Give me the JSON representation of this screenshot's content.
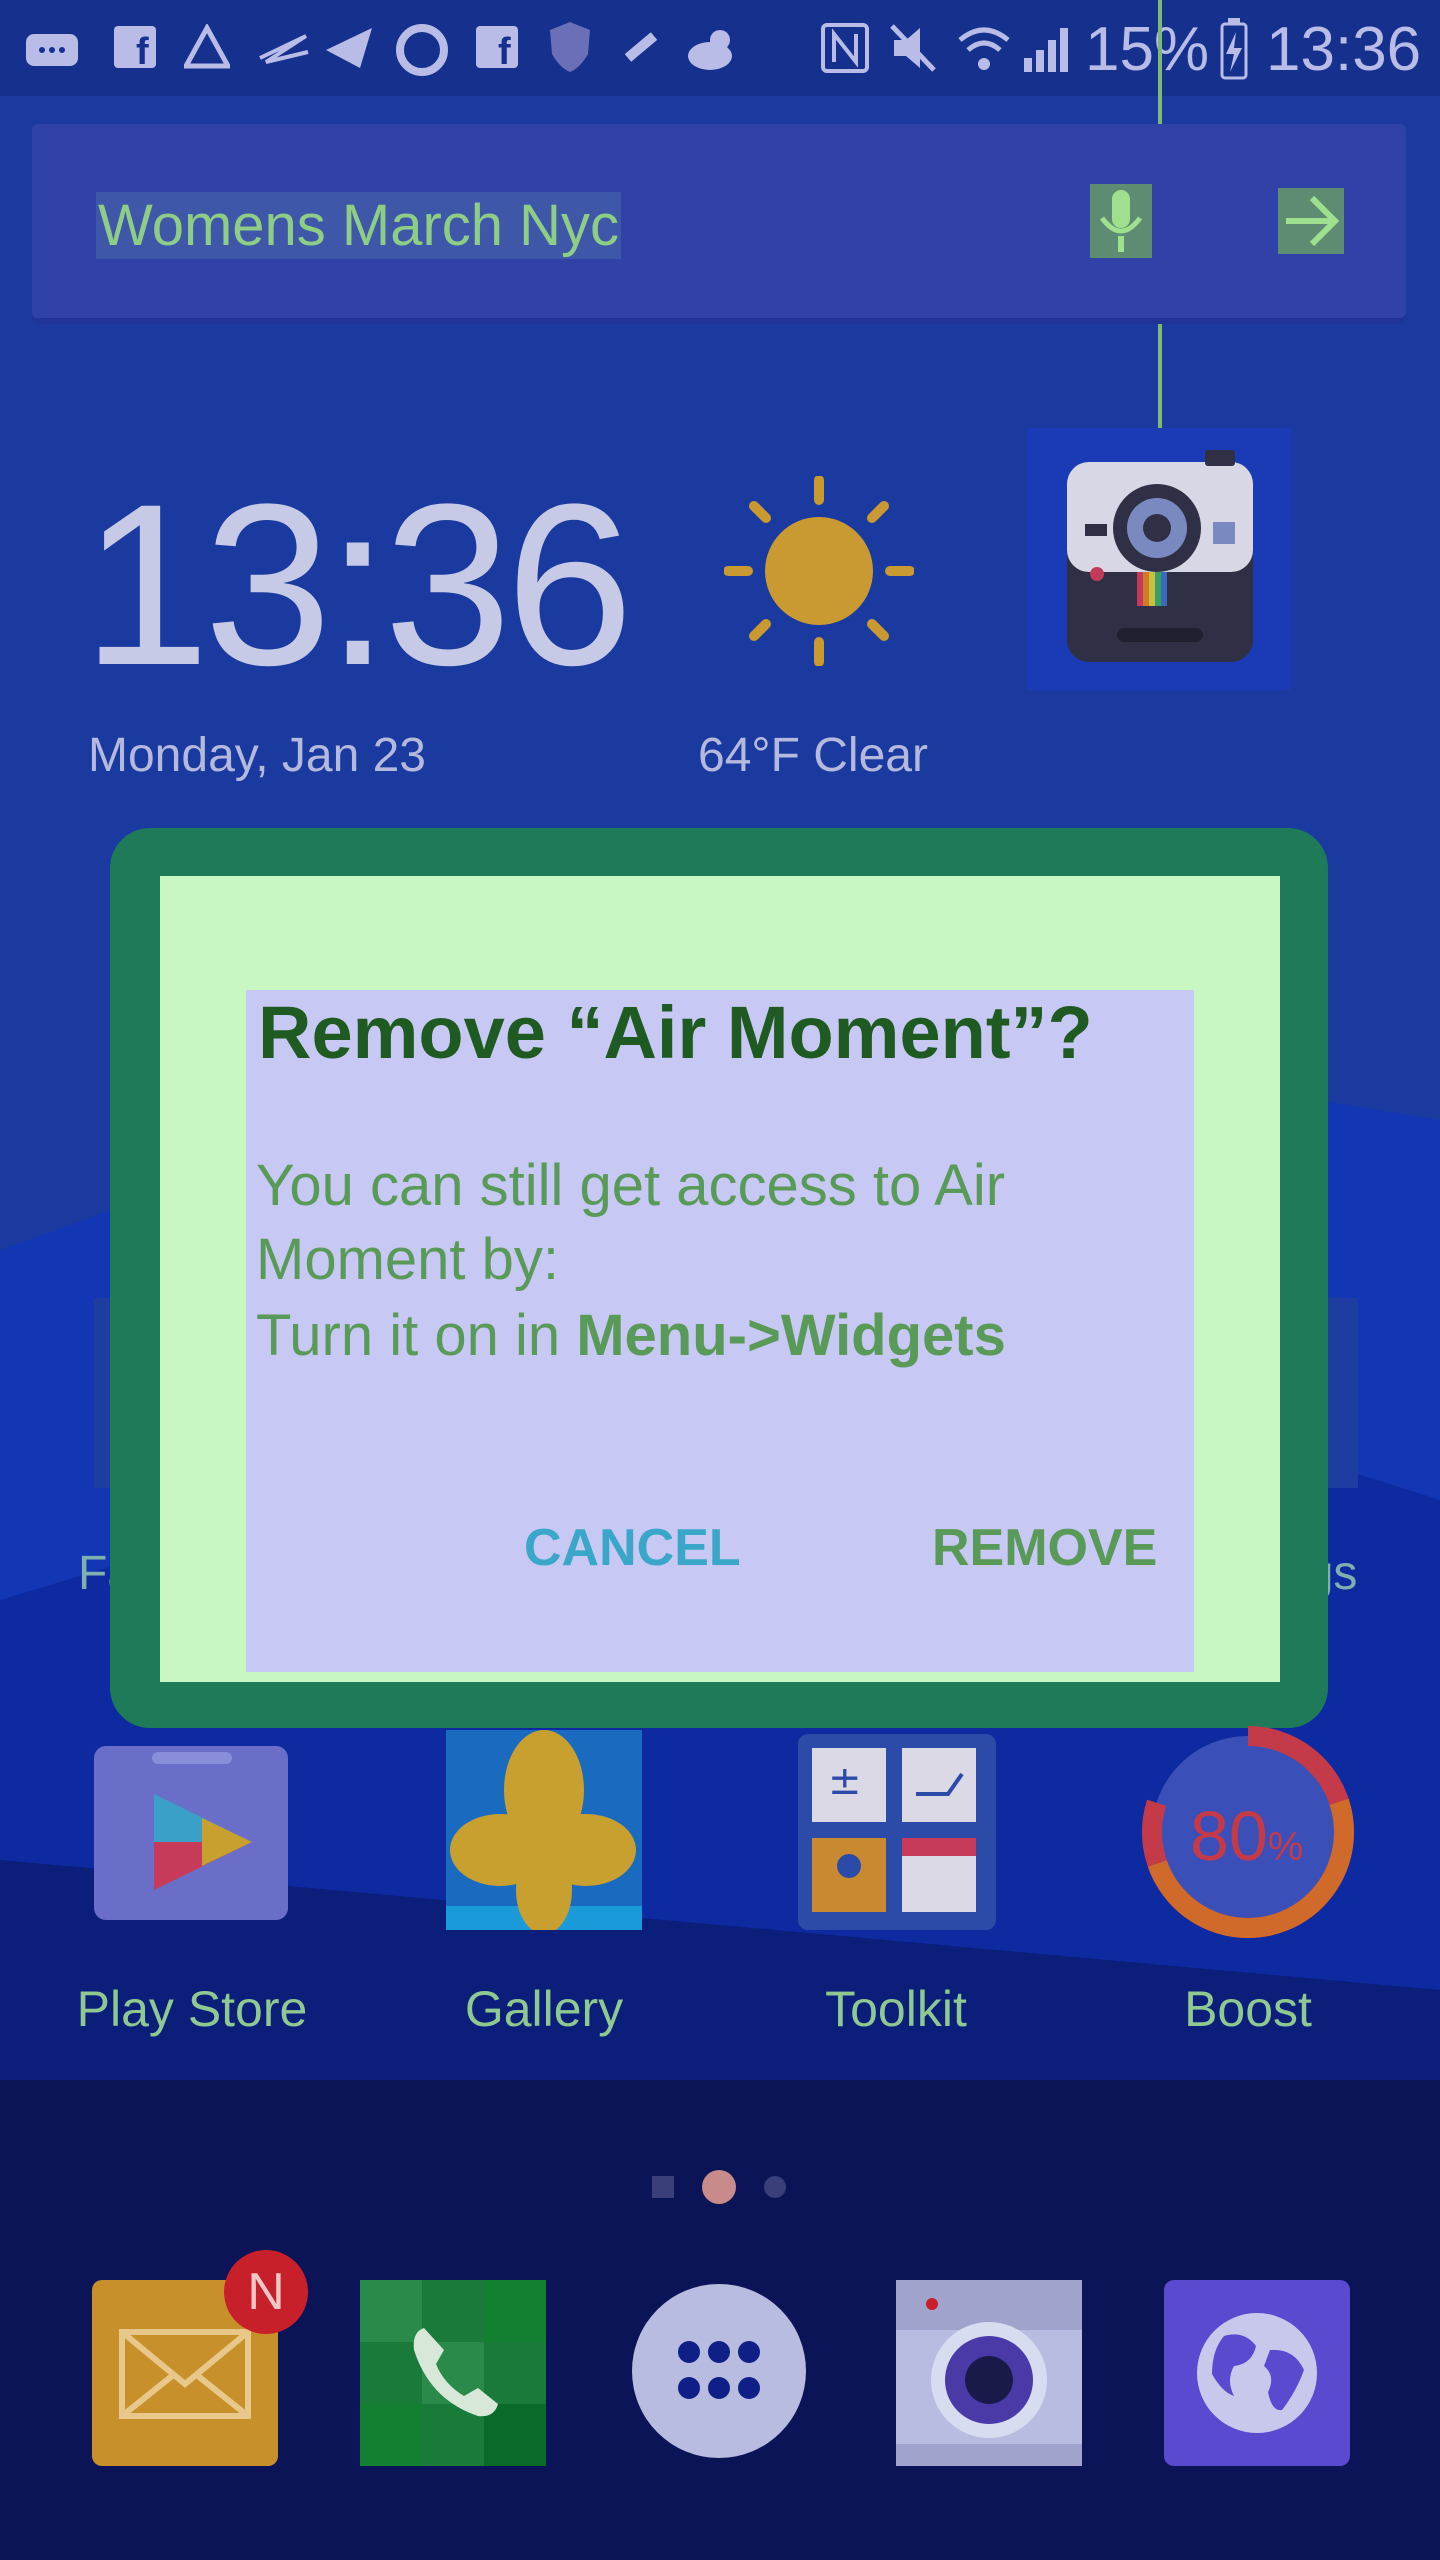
{
  "status_bar": {
    "battery": "15%",
    "time": "13:36",
    "icons": [
      "message-icon",
      "facebook-icon",
      "warning-icon",
      "zigzag-icon",
      "paper-plane-icon",
      "circle-icon",
      "facebook-icon",
      "shield-icon",
      "tool-icon",
      "weather-icon",
      "nfc-icon",
      "mute-icon",
      "wifi-icon",
      "signal-icon",
      "battery-icon"
    ]
  },
  "search": {
    "query": "Womens March Nyc",
    "mic_icon": "mic-icon",
    "go_icon": "arrow-right-icon"
  },
  "clock_widget": {
    "time": "13:36",
    "date": "Monday, Jan 23",
    "weather": "64°F Clear",
    "weather_icon": "sun-icon"
  },
  "dialog": {
    "title": "Remove “Air Moment”?",
    "message_line1": "You can still get access to Air",
    "message_line2": "Moment by:",
    "message_line3_prefix": "Turn it on in ",
    "message_line3_bold": "Menu->Widgets",
    "cancel_label": "CANCEL",
    "remove_label": "REMOVE"
  },
  "partial_labels": {
    "left": "Fac",
    "right": "ngs"
  },
  "apps": [
    {
      "label": "Play Store",
      "icon": "play-store-icon"
    },
    {
      "label": "Gallery",
      "icon": "gallery-icon"
    },
    {
      "label": "Toolkit",
      "icon": "toolkit-icon"
    },
    {
      "label": "Boost",
      "icon": "boost-icon"
    }
  ],
  "boost": {
    "value": "80",
    "unit": "%"
  },
  "dock": {
    "email_badge": "N",
    "items": [
      "email-icon",
      "phone-icon",
      "apps-drawer-icon",
      "camera-icon",
      "browser-icon"
    ]
  },
  "colors": {
    "accent_green": "#5a9a58",
    "cancel_blue": "#3aa6c8",
    "dialog_bg": "#c8f7c4",
    "content_bg": "#c8c8f4"
  }
}
